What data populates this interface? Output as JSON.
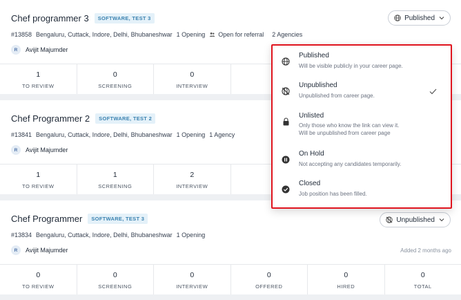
{
  "jobs": [
    {
      "title": "Chef programmer 3",
      "tag": "SOFTWARE, TEST 3",
      "id": "#13858",
      "locations": "Bengaluru, Cuttack, Indore, Delhi, Bhubaneshwar",
      "openings": "1 Opening",
      "referral": "Open for referral",
      "agencies": "2 Agencies",
      "owner_initial": "R",
      "owner": "Avijit Majumder",
      "status": "Published",
      "stats": [
        {
          "value": "1",
          "label": "TO REVIEW"
        },
        {
          "value": "0",
          "label": "SCREENING"
        },
        {
          "value": "0",
          "label": "INTERVIEW"
        }
      ]
    },
    {
      "title": "Chef Programmer 2",
      "tag": "SOFTWARE, TEST 2",
      "id": "#13841",
      "locations": "Bengaluru, Cuttack, Indore, Delhi, Bhubaneshwar",
      "openings": "1 Opening",
      "agencies": "1 Agency",
      "owner_initial": "R",
      "owner": "Avijit Majumder",
      "stats": [
        {
          "value": "1",
          "label": "TO REVIEW"
        },
        {
          "value": "1",
          "label": "SCREENING"
        },
        {
          "value": "2",
          "label": "INTERVIEW"
        }
      ]
    },
    {
      "title": "Chef Programmer",
      "tag": "SOFTWARE, TEST 3",
      "id": "#13834",
      "locations": "Bengaluru, Cuttack, Indore, Delhi, Bhubaneshwar",
      "openings": "1 Opening",
      "owner_initial": "R",
      "owner": "Avijit Majumder",
      "status": "Unpublished",
      "added": "Added 2 months ago",
      "stats": [
        {
          "value": "0",
          "label": "TO REVIEW"
        },
        {
          "value": "0",
          "label": "SCREENING"
        },
        {
          "value": "0",
          "label": "INTERVIEW"
        },
        {
          "value": "0",
          "label": "OFFERED"
        },
        {
          "value": "0",
          "label": "HIRED"
        },
        {
          "value": "0",
          "label": "TOTAL"
        }
      ]
    }
  ],
  "status_menu": {
    "options": [
      {
        "icon": "globe-icon",
        "title": "Published",
        "desc": "Will be visible publicly in your career page."
      },
      {
        "icon": "unpublished-icon",
        "title": "Unpublished",
        "desc": "Unpublished from career page.",
        "selected": true
      },
      {
        "icon": "lock-icon",
        "title": "Unlisted",
        "desc": "Only those who know the link can view it.",
        "desc2": "Will be unpublished from career page"
      },
      {
        "icon": "pause-icon",
        "title": "On Hold",
        "desc": "Not accepting any candidates temporarily."
      },
      {
        "icon": "check-circle-icon",
        "title": "Closed",
        "desc": "Job position has been filled."
      }
    ]
  },
  "colors": {
    "highlight_border": "#e0141e",
    "tag_bg": "#e4f1f9",
    "tag_text": "#3b82b0"
  }
}
